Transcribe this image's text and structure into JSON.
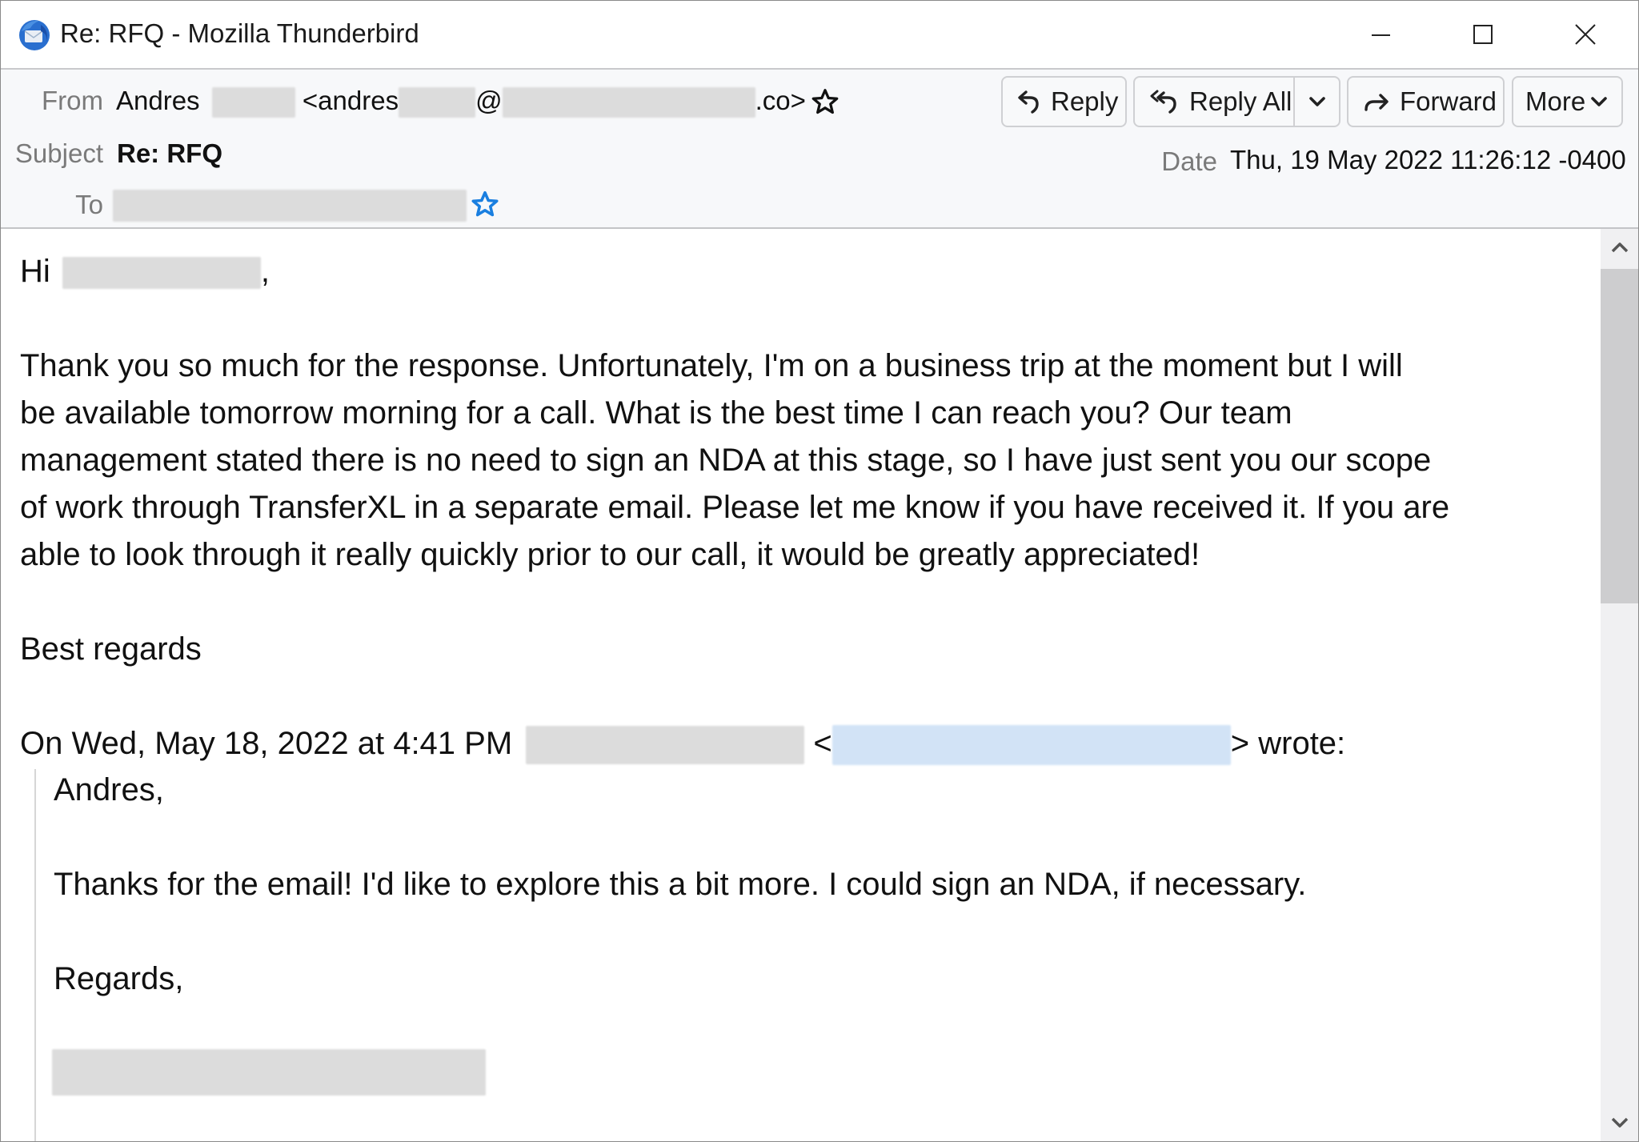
{
  "window": {
    "title": "Re: RFQ - Mozilla Thunderbird",
    "app_icon": "thunderbird-logo-icon",
    "controls": [
      "minimize",
      "maximize",
      "close"
    ]
  },
  "header": {
    "from_label": "From",
    "from_name": "Andres",
    "from_email_prefix": "<andres",
    "from_email_at": "@",
    "from_email_suffix": ".co>",
    "subject_label": "Subject",
    "subject": "Re: RFQ",
    "to_label": "To",
    "date_label": "Date",
    "date": "Thu, 19 May 2022 11:26:12 -0400",
    "buttons": {
      "reply": "Reply",
      "reply_all": "Reply All",
      "forward": "Forward",
      "more": "More"
    }
  },
  "body": {
    "greeting": "Hi",
    "greeting_comma": ",",
    "paragraph_lines": [
      "Thank you so much for the response. Unfortunately, I'm on a business trip at the moment but I will",
      "be available tomorrow morning for a call. What is the best time I can reach you? Our team",
      "management stated there is no need to sign an NDA at this stage, so I have just sent you our scope",
      "of work through TransferXL in a separate email. Please let me know if you have received it. If you are",
      "able to look through it really quickly prior to our call, it would be greatly appreciated!"
    ],
    "signoff": "Best regards",
    "quote_header_prefix": "On Wed, May 18, 2022 at 4:41 PM",
    "quote_header_lt": "<",
    "quote_header_suffix": "> wrote:",
    "quoted": {
      "salutation": "Andres,",
      "line": "Thanks for the email!  I'd like to explore this a bit more.  I could sign an NDA, if necessary.",
      "closing": "Regards,"
    }
  },
  "colors": {
    "header_bg": "#f7f8fa",
    "star_accent": "#1a7fe0",
    "label_gray": "#7a7a7a",
    "scroll_thumb": "#cdcdcf"
  }
}
